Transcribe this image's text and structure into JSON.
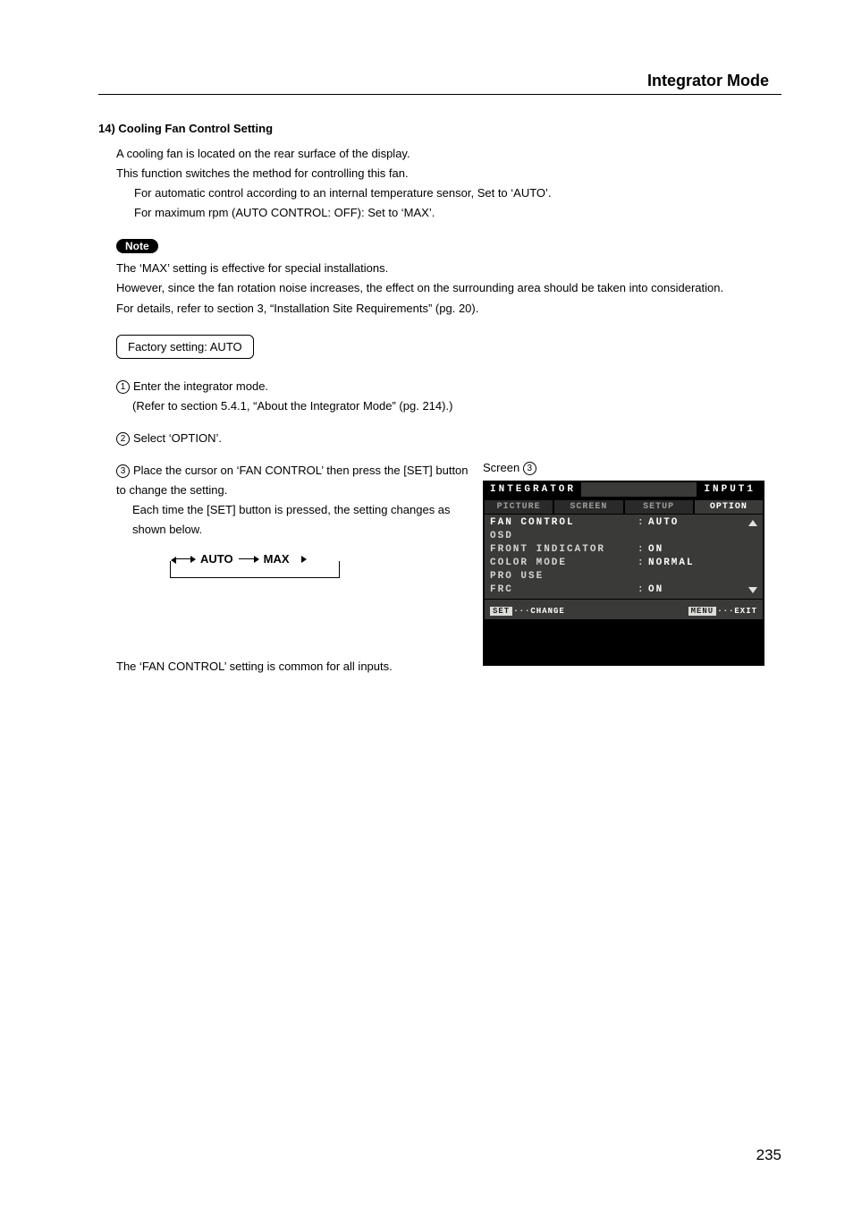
{
  "header": {
    "title": "Integrator Mode"
  },
  "section": {
    "number": "14)",
    "title": "Cooling Fan Control Setting"
  },
  "body": {
    "l1": "A cooling fan is located on the rear surface of the display.",
    "l2": "This function switches the method for controlling this fan.",
    "l3": "For automatic control according to an internal temperature sensor, Set to ‘AUTO’.",
    "l4": "For maximum rpm (AUTO CONTROL: OFF): Set to ‘MAX’."
  },
  "note": {
    "badge": "Note",
    "l1": "The ‘MAX’ setting is effective for special installations.",
    "l2": "However, since the fan rotation noise increases, the effect on the surrounding area should be taken into consideration.",
    "l3": "For details, refer to section 3, “Installation Site Requirements” (pg. 20)."
  },
  "factory": "Factory setting:  AUTO",
  "steps": {
    "s1a": "Enter the integrator mode.",
    "s1b": "(Refer to section 5.4.1, “About the Integrator Mode” (pg. 214).)",
    "s2": "Select ‘OPTION’.",
    "s3a": "Place the cursor on ‘FAN CONTROL’ then press the [SET] button to change the setting.",
    "s3b": "Each time the [SET] button is pressed, the setting changes as shown below."
  },
  "cycle": {
    "a": "AUTO",
    "b": "MAX"
  },
  "screen_label": "Screen ",
  "osd": {
    "title": "INTEGRATOR",
    "input": "INPUT1",
    "tabs": [
      "PICTURE",
      "SCREEN",
      "SETUP",
      "OPTION"
    ],
    "items": [
      {
        "label": "FAN CONTROL",
        "val": "AUTO",
        "colon": ":"
      },
      {
        "label": "OSD",
        "val": "",
        "colon": ""
      },
      {
        "label": "FRONT INDICATOR",
        "val": "ON",
        "colon": ":"
      },
      {
        "label": "COLOR MODE",
        "val": "NORMAL",
        "colon": ":"
      },
      {
        "label": "PRO USE",
        "val": "",
        "colon": ""
      },
      {
        "label": "FRC",
        "val": "ON",
        "colon": ":"
      }
    ],
    "footer": {
      "set_key": "SET",
      "set_label": "···CHANGE",
      "menu_key": "MENU",
      "menu_label": "···EXIT"
    }
  },
  "common_note": "The ‘FAN CONTROL’ setting is common for all inputs.",
  "page_number": "235"
}
